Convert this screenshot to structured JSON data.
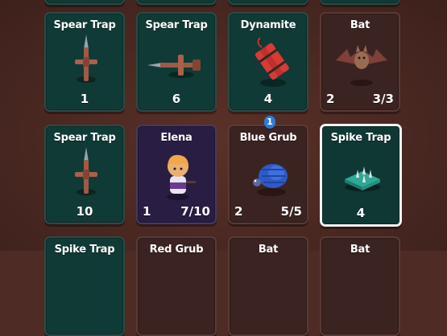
{
  "rows": {
    "top": [
      {
        "title": "Spear Trap",
        "count": "1"
      },
      {
        "title": "Spear Trap",
        "count": "6"
      },
      {
        "title": "Dynamite",
        "count": "4"
      },
      {
        "title": "Bat",
        "level": "2",
        "fraction": "3/3"
      }
    ],
    "middle": [
      {
        "title": "Spear Trap",
        "count": "10"
      },
      {
        "title": "Elena",
        "level": "1",
        "fraction": "7/10"
      },
      {
        "title": "Blue Grub",
        "level": "2",
        "fraction": "5/5",
        "badge": "1"
      },
      {
        "title": "Spike Trap",
        "count": "4"
      }
    ],
    "bottom": [
      {
        "title": "Spike Trap"
      },
      {
        "title": "Red Grub"
      },
      {
        "title": "Bat"
      },
      {
        "title": "Bat"
      }
    ]
  },
  "colors": {
    "trap_card": "#103a36",
    "hero_card": "#2a1d44",
    "monster_card": "#3b2321",
    "selected_border": "#f2f2f2",
    "badge": "#2e7bd9"
  },
  "icons": {
    "spear_trap": "spear-trap-icon",
    "dynamite": "dynamite-icon",
    "bat": "bat-icon",
    "hero": "elena-hero-icon",
    "grub": "blue-grub-icon",
    "spike_trap": "spike-trap-icon"
  }
}
